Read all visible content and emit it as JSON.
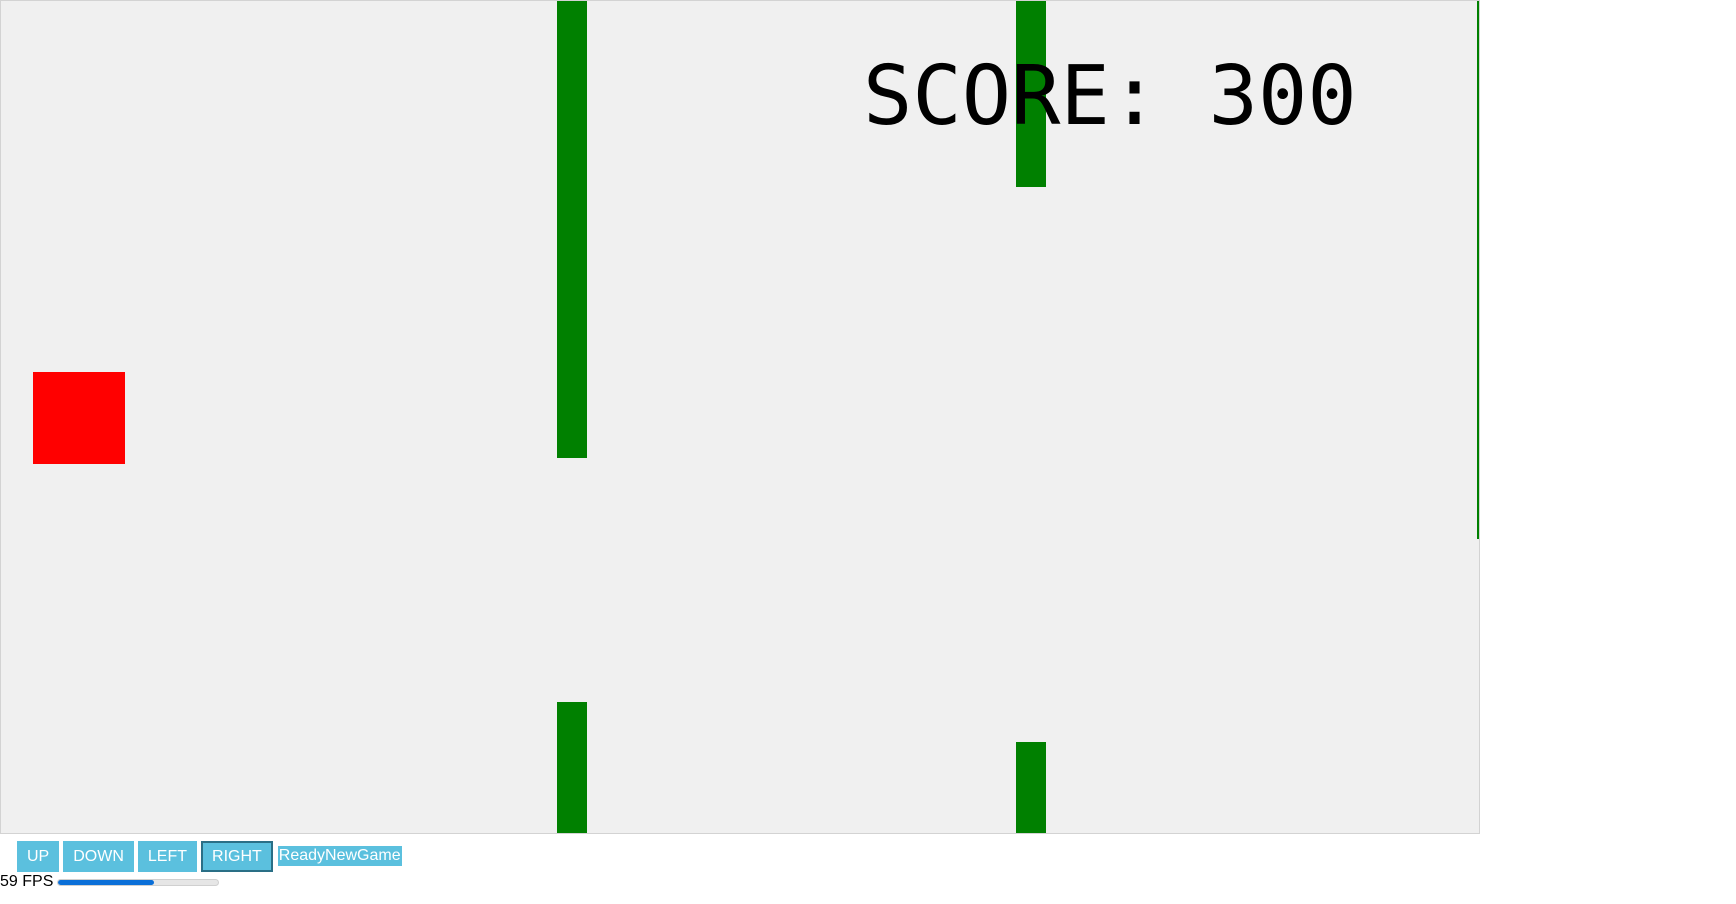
{
  "game": {
    "score_label": "SCORE:",
    "score_value": "300",
    "player_color": "#ff0000",
    "obstacle_color": "#008000",
    "canvas_background": "#f0f0f0"
  },
  "controls": {
    "up_label": "UP",
    "down_label": "DOWN",
    "left_label": "LEFT",
    "right_label": "RIGHT",
    "ready_label": "ReadyNewGame",
    "button_color": "#5bc0de"
  },
  "fps": {
    "value": "59",
    "unit": "FPS",
    "bar_fraction": 0.6,
    "bar_color": "#0a6fd8"
  }
}
